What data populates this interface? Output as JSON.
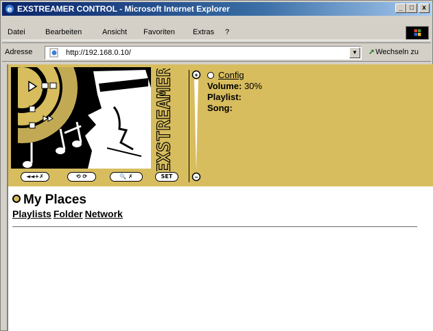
{
  "window": {
    "title": "EXSTREAMER CONTROL - Microsoft Internet Explorer",
    "minimize": "_",
    "maximize": "□",
    "close": "x"
  },
  "menu": [
    "Datei",
    "Bearbeiten",
    "Ansicht",
    "Favoriten",
    "Extras",
    "?"
  ],
  "address": {
    "label": "Adresse",
    "url": "http://192.168.0.10/",
    "go_label": "Wechseln zu"
  },
  "player": {
    "brand": "EXSTREAMER",
    "config": "Config",
    "volume_label": "Volume:",
    "volume_value": "30%",
    "playlist_label": "Playlist:",
    "song_label": "Song:",
    "vol_plus": "+",
    "vol_minus": "−",
    "buttons": [
      "◄◄+✗",
      "⟲ ⟳",
      "🔍 ✗",
      "SET"
    ]
  },
  "places": {
    "title": "My Places",
    "links": [
      "Playlists",
      "Folder",
      "Network"
    ]
  }
}
